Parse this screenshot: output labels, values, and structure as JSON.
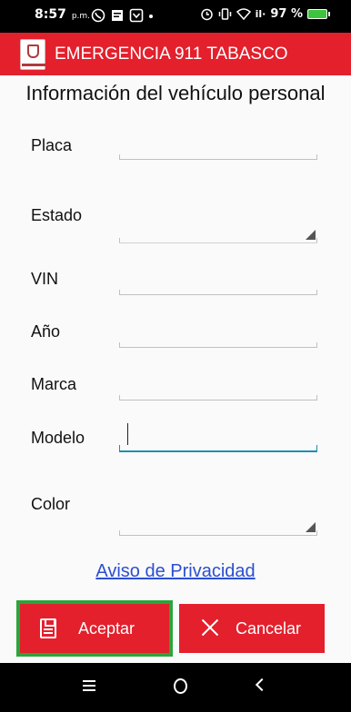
{
  "status": {
    "time": "8:57",
    "ampm": "p.m.",
    "battery": "97 %",
    "signal": "il·"
  },
  "app": {
    "title": "EMERGENCIA 911 TABASCO",
    "accent": "#e3202c",
    "active_line": "#1a8fb2"
  },
  "page": {
    "title": "Información del vehículo personal"
  },
  "form": {
    "placa": {
      "label": "Placa",
      "value": ""
    },
    "estado": {
      "label": "Estado",
      "value": ""
    },
    "vin": {
      "label": "VIN",
      "value": ""
    },
    "anio": {
      "label": "Año",
      "value": ""
    },
    "marca": {
      "label": "Marca",
      "value": ""
    },
    "modelo": {
      "label": "Modelo",
      "value": ""
    },
    "color": {
      "label": "Color",
      "value": ""
    }
  },
  "links": {
    "privacy": "Aviso de Privacidad"
  },
  "buttons": {
    "accept": "Aceptar",
    "cancel": "Cancelar"
  },
  "icons": [
    "whatsapp-icon",
    "message-icon",
    "notification-icon",
    "alarm-icon",
    "vibrate-icon",
    "wifi-icon",
    "signal-icon",
    "battery-icon",
    "save-icon",
    "close-icon",
    "recents-icon",
    "home-icon",
    "back-icon"
  ]
}
